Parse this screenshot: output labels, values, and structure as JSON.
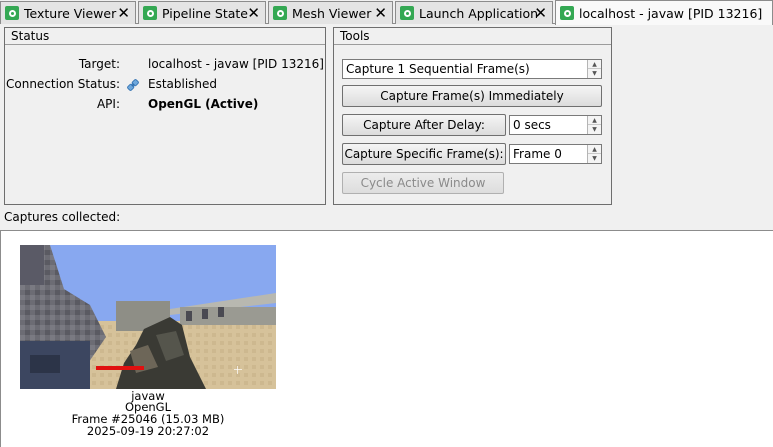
{
  "tabs": [
    {
      "label": "Texture Viewer",
      "active": false
    },
    {
      "label": "Pipeline State",
      "active": false
    },
    {
      "label": "Mesh Viewer",
      "active": false
    },
    {
      "label": "Launch Application",
      "active": false
    },
    {
      "label": "localhost - javaw [PID 13216]",
      "active": true
    }
  ],
  "tab_close_glyph": "✕",
  "status": {
    "title": "Status",
    "target_label": "Target:",
    "target_value": "localhost - javaw [PID 13216]",
    "connection_label": "Connection Status:",
    "connection_value": "Established",
    "api_label": "API:",
    "api_value": "OpenGL (Active)"
  },
  "tools": {
    "title": "Tools",
    "capture_mode": "Capture 1 Sequential Frame(s)",
    "capture_immediately": "Capture Frame(s) Immediately",
    "capture_after_delay": "Capture After Delay:",
    "delay_value": "0 secs",
    "capture_specific": "Capture Specific Frame(s):",
    "frame_value": "Frame 0",
    "cycle_window": "Cycle Active Window"
  },
  "captures": {
    "label": "Captures collected:",
    "items": [
      {
        "name": "javaw",
        "api": "OpenGL",
        "frame": "Frame #25046 (15.03 MB)",
        "timestamp": "2025-09-19 20:27:02"
      }
    ]
  },
  "icons": {
    "tab": "renderdoc-tab-icon",
    "connection": "connection-established-icon"
  },
  "colors": {
    "tab_icon": "#34a853",
    "health_bar": "#e01010"
  }
}
